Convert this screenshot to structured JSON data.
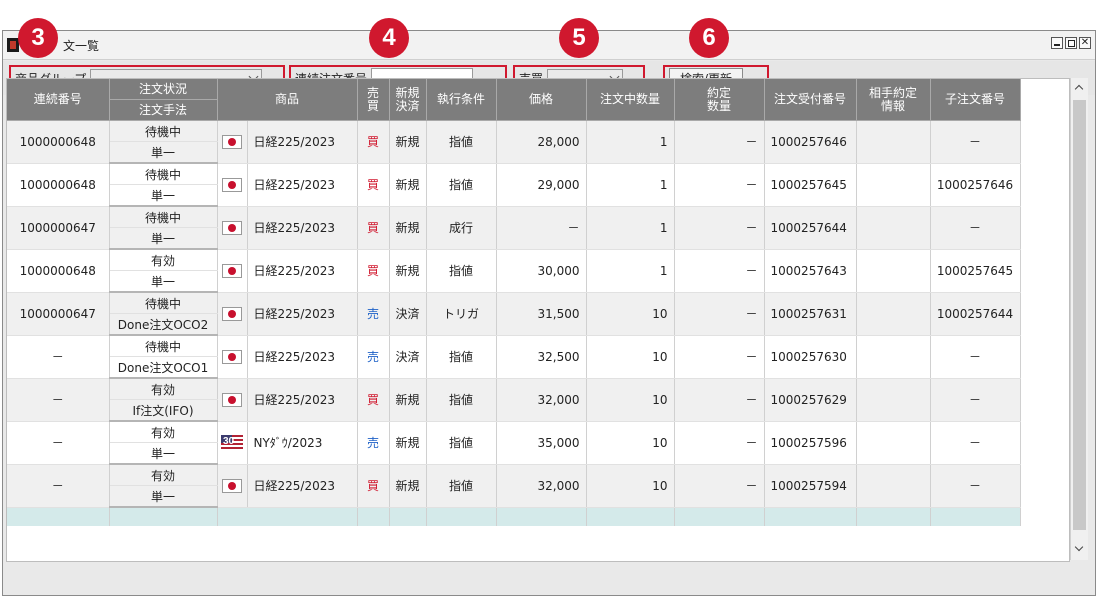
{
  "window": {
    "title": "文一覧"
  },
  "callouts": [
    "3",
    "4",
    "5",
    "6"
  ],
  "toolbar": {
    "product_group_label": "商品グループ",
    "product_group_value": "",
    "order_no_label": "連続注文番号",
    "order_no_value": "",
    "side_label": "売買",
    "side_value": "",
    "search_button": "検索/更新"
  },
  "table": {
    "headers": {
      "serial": "連続番号",
      "status_top": "注文状況",
      "status_bottom": "注文手法",
      "product": "商品",
      "side": "売\n買",
      "newclose": "新規\n決済",
      "condition": "執行条件",
      "price": "価格",
      "qty": "注文中数量",
      "filled": "約定\n数量",
      "receipt": "注文受付番号",
      "counter": "相手約定\n情報",
      "child": "子注文番号"
    },
    "rows": [
      {
        "serial": "1000000648",
        "status": "待機中",
        "method": "単一",
        "flag": "jp",
        "product": "日経225/2023",
        "side": "買",
        "side_type": "buy",
        "newclose": "新規",
        "condition": "指値",
        "price": "28,000",
        "qty": "1",
        "filled": "－",
        "receipt": "1000257646",
        "counter": "",
        "child": "－"
      },
      {
        "serial": "1000000648",
        "status": "待機中",
        "method": "単一",
        "flag": "jp",
        "product": "日経225/2023",
        "side": "買",
        "side_type": "buy",
        "newclose": "新規",
        "condition": "指値",
        "price": "29,000",
        "qty": "1",
        "filled": "－",
        "receipt": "1000257645",
        "counter": "",
        "child": "1000257646"
      },
      {
        "serial": "1000000647",
        "status": "待機中",
        "method": "単一",
        "flag": "jp",
        "product": "日経225/2023",
        "side": "買",
        "side_type": "buy",
        "newclose": "新規",
        "condition": "成行",
        "price": "－",
        "qty": "1",
        "filled": "－",
        "receipt": "1000257644",
        "counter": "",
        "child": "－"
      },
      {
        "serial": "1000000648",
        "status": "有効",
        "method": "単一",
        "flag": "jp",
        "product": "日経225/2023",
        "side": "買",
        "side_type": "buy",
        "newclose": "新規",
        "condition": "指値",
        "price": "30,000",
        "qty": "1",
        "filled": "－",
        "receipt": "1000257643",
        "counter": "",
        "child": "1000257645"
      },
      {
        "serial": "1000000647",
        "status": "待機中",
        "method": "Done注文OCO2",
        "flag": "jp",
        "product": "日経225/2023",
        "side": "売",
        "side_type": "sell",
        "newclose": "決済",
        "condition": "トリガ",
        "price": "31,500",
        "qty": "10",
        "filled": "－",
        "receipt": "1000257631",
        "counter": "",
        "child": "1000257644"
      },
      {
        "serial": "－",
        "status": "待機中",
        "method": "Done注文OCO1",
        "flag": "jp",
        "product": "日経225/2023",
        "side": "売",
        "side_type": "sell",
        "newclose": "決済",
        "condition": "指値",
        "price": "32,500",
        "qty": "10",
        "filled": "－",
        "receipt": "1000257630",
        "counter": "",
        "child": "－"
      },
      {
        "serial": "－",
        "status": "有効",
        "method": "If注文(IFO)",
        "flag": "jp",
        "product": "日経225/2023",
        "side": "買",
        "side_type": "buy",
        "newclose": "新規",
        "condition": "指値",
        "price": "32,000",
        "qty": "10",
        "filled": "－",
        "receipt": "1000257629",
        "counter": "",
        "child": "－"
      },
      {
        "serial": "－",
        "status": "有効",
        "method": "単一",
        "flag": "us",
        "flag_text": "30",
        "product": "NYﾀﾞｳ/2023",
        "side": "売",
        "side_type": "sell",
        "newclose": "新規",
        "condition": "指値",
        "price": "35,000",
        "qty": "10",
        "filled": "－",
        "receipt": "1000257596",
        "counter": "",
        "child": "－"
      },
      {
        "serial": "－",
        "status": "有効",
        "method": "単一",
        "flag": "jp",
        "product": "日経225/2023",
        "side": "買",
        "side_type": "buy",
        "newclose": "新規",
        "condition": "指値",
        "price": "32,000",
        "qty": "10",
        "filled": "－",
        "receipt": "1000257594",
        "counter": "",
        "child": "－"
      }
    ]
  },
  "colors": {
    "callout": "#d0182e",
    "header_bg": "#7d7d7d",
    "buy": "#d0182e",
    "sell": "#1f62c7"
  }
}
